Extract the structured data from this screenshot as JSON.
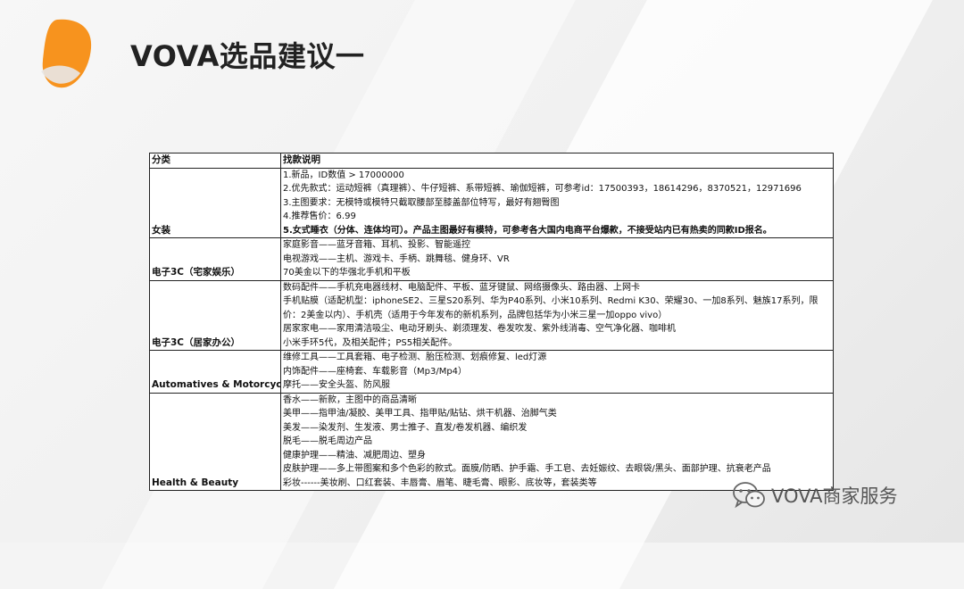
{
  "title": "VOVA选品建议一",
  "colors": {
    "accent": "#f7931e",
    "text": "#222222",
    "border": "#222222"
  },
  "table": {
    "headers": [
      "分类",
      "找款说明"
    ],
    "rows": [
      {
        "category": "女装",
        "lines": [
          "1.新品，ID数值 > 17000000",
          "2.优先款式：运动短裤（真理裤）、牛仔短裤、系带短裤、瑜伽短裤，可参考id：17500393，18614296，8370521，12971696",
          "3.主图要求：无模特或模特只截取腰部至膝盖部位特写，最好有翘臀图",
          "4.推荐售价：6.99",
          "5.女式睡衣（分体、连体均可）。产品主图最好有模特，可参考各大国内电商平台爆款，不接受站内已有热卖的同款ID报名。"
        ]
      },
      {
        "category": "电子3C（宅家娱乐）",
        "lines": [
          "家庭影音——蓝牙音箱、耳机、投影、智能遥控",
          "电视游戏——主机、游戏卡、手柄、跳舞毯、健身环、VR",
          "70美金以下的华强北手机和平板"
        ]
      },
      {
        "category": "电子3C（居家办公）",
        "lines": [
          "数码配件——手机充电器线材、电脑配件、平板、蓝牙键鼠、网络摄像头、路由器、上网卡",
          "手机贴膜（适配机型：iphoneSE2、三星S20系列、华为P40系列、小米10系列、Redmi K30、荣耀30、一加8系列、魅族17系列，限价：2美金以内）、手机壳（适用于今年发布的新机系列，品牌包括华为小米三星一加oppo vivo）",
          "居家家电——家用清洁吸尘、电动牙刷头、剃须理发、卷发吹发、紫外线消毒、空气净化器、咖啡机",
          "小米手环5代，及相关配件；PS5相关配件。"
        ]
      },
      {
        "category": "Automatives & Motorcycles",
        "lines": [
          "维修工具——工具套箱、电子检测、胎压检测、划痕修复、led灯源",
          "内饰配件——座椅套、车载影音（Mp3/Mp4）",
          "摩托——安全头盔、防风服"
        ]
      },
      {
        "category": "Health & Beauty",
        "lines": [
          "香水——新款，主图中的商品清晰",
          "美甲——指甲油/凝胶、美甲工具、指甲贴/贴钻、烘干机器、治脚气类",
          "美发——染发剂、生发液、男士推子、直发/卷发机器、编织发",
          "脱毛——脱毛周边产品",
          "健康护理——精油、减肥周边、塑身",
          "皮肤护理——多上带图案和多个色彩的款式。面膜/防晒、护手霜、手工皂、去妊娠纹、去眼袋/黑头、面部护理、抗衰老产品",
          "彩妆------美妆刷、口红套装、丰唇膏、眉笔、睫毛膏、眼影、底妆等，套装类等"
        ]
      }
    ]
  },
  "watermark": {
    "text": "VOVA商家服务",
    "icon": "wechat-icon"
  }
}
